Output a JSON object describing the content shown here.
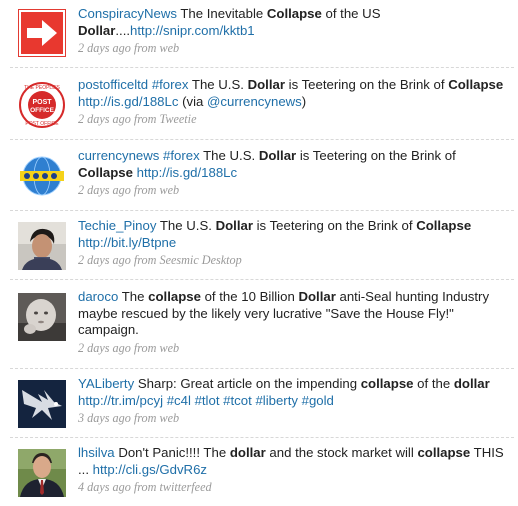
{
  "tweets": [
    {
      "user": "ConspiracyNews",
      "t1": " The Inevitable ",
      "k1": "Collapse",
      "t2": " of the US ",
      "k2": "Dollar",
      "t3": "....",
      "link": "http://snipr.com/kktb1",
      "time": "2 days ago from web",
      "avatar_icon": "red-arrow-icon"
    },
    {
      "user": "postofficeltd",
      "tag": "#forex",
      "t1": " The U.S. ",
      "k1": "Dollar",
      "t2": " is Teetering on the Brink of ",
      "k2": "Collapse",
      "link": "http://is.gd/188Lc",
      "t3": " (via ",
      "mention": "@currencynews",
      "t4": ")",
      "time": "2 days ago from Tweetie",
      "logo_top": "THE PEOPLE'S",
      "logo_mid1": "POST",
      "logo_mid2": "OFFICE",
      "logo_bottom": "POST OFFICE",
      "avatar_icon": "post-office-logo-icon"
    },
    {
      "user": "currencynews",
      "tag": "#forex",
      "t1": " The U.S. ",
      "k1": "Dollar",
      "t2": " is Teetering on the Brink of ",
      "k2": "Collapse",
      "link": "http://is.gd/188Lc",
      "time": "2 days ago from web",
      "avatar_icon": "currency-globe-icon"
    },
    {
      "user": "Techie_Pinoy",
      "t1": " The U.S. ",
      "k1": "Dollar",
      "t2": " is Teetering on the Brink of ",
      "k2": "Collapse",
      "link": "http://bit.ly/Btpne",
      "time": "2 days ago from Seesmic Desktop",
      "avatar_icon": "user-photo-icon"
    },
    {
      "user": "daroco",
      "t1": " The ",
      "k1": "collapse",
      "t2": " of the 10 Billion ",
      "k2": "Dollar",
      "t3": " anti-Seal hunting Industry maybe rescued by the likely very lucrative \"Save the House Fly!\" campaign.",
      "time": "2 days ago from web",
      "avatar_icon": "baby-photo-icon"
    },
    {
      "user": "YALiberty",
      "t1": " Sharp: Great article on the impending ",
      "k1": "collapse",
      "t2": " of the ",
      "k2": "dollar",
      "link": "http://tr.im/pcyj",
      "tags": [
        "#c4l",
        "#tlot",
        "#tcot",
        "#liberty",
        "#gold"
      ],
      "time": "3 days ago from web",
      "avatar_icon": "eagle-icon"
    },
    {
      "user": "lhsilva",
      "t1": " Don't Panic!!!! The ",
      "k1": "dollar",
      "t2": " and the stock market will ",
      "k2": "collapse",
      "t3": " THIS ... ",
      "link": "http://cli.gs/GdvR6z",
      "time": "4 days ago from twitterfeed",
      "avatar_icon": "man-in-suit-photo-icon"
    }
  ]
}
